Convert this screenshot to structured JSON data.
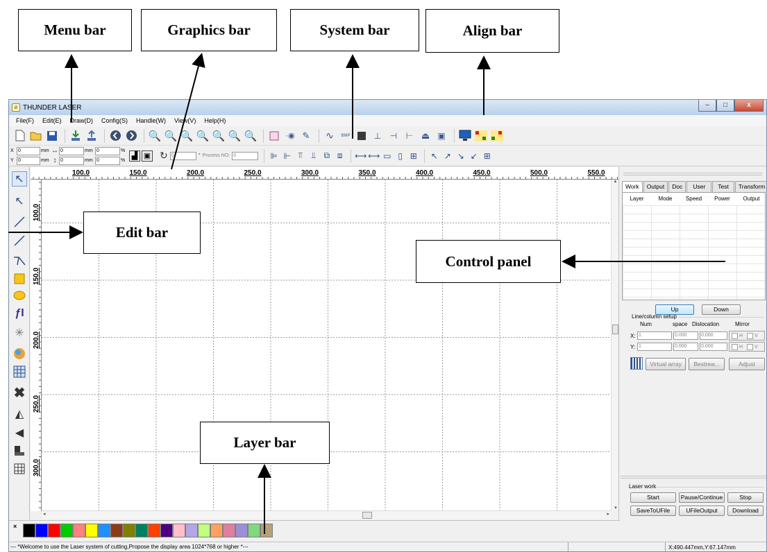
{
  "callouts": {
    "menu_bar": "Menu bar",
    "graphics_bar": "Graphics bar",
    "system_bar": "System bar",
    "align_bar": "Align bar",
    "edit_bar": "Edit bar",
    "control_panel": "Control panel",
    "layer_bar": "Layer bar"
  },
  "window": {
    "title": "THUNDER LASER",
    "controls": {
      "minimize": "–",
      "maximize": "□",
      "close": "x"
    }
  },
  "menu": [
    "File(F)",
    "Edit(E)",
    "Draw(D)",
    "Config(S)",
    "Handle(W)",
    "View(V)",
    "Help(H)"
  ],
  "toolbar1_icons": [
    "new-file-icon",
    "open-folder-icon",
    "save-icon",
    "import-icon",
    "export-icon",
    "back-icon",
    "forward-icon",
    "zoom-in-icon",
    "zoom-out-icon",
    "zoom-window-icon",
    "zoom-fit-icon",
    "zoom-page-icon",
    "zoom-data-icon",
    "zoom-icon",
    "frame-icon",
    "node-icon",
    "curve-edit-icon",
    "smooth-icon",
    "bitmap-icon",
    "stop-square-icon",
    "network-icon",
    "hmirror-icon",
    "vmirror-icon",
    "machine-icon",
    "output-icon",
    "monitor-icon",
    "align-grid-icon",
    "align-grid2-icon"
  ],
  "position_bar": {
    "x_label": "X",
    "y_label": "Y",
    "x_value": "0",
    "y_value": "0",
    "w_value": "0",
    "h_value": "0",
    "x_scale": "0",
    "y_scale": "0",
    "unit": "mm",
    "percent": "%",
    "angle_value": "0",
    "degree": "°",
    "process_label": "Process NO:",
    "process_value": "0"
  },
  "toolbar2_icons": [
    "align-left-icon",
    "align-right-icon",
    "align-top-icon",
    "align-bottom-icon",
    "align-hcenter-icon",
    "align-vcenter-icon",
    "same-width-icon",
    "same-height-icon",
    "same-size-icon",
    "space-h-icon",
    "space-v-icon",
    "arrow-nw-icon",
    "arrow-ne-icon",
    "arrow-se-icon",
    "arrow-sw-icon",
    "center-icon"
  ],
  "edit_bar_icons": [
    "select-arrow-icon",
    "node-edit-icon",
    "line-icon",
    "polyline-icon",
    "curve-icon",
    "rectangle-icon",
    "ellipse-icon",
    "text-icon",
    "point-icon",
    "bitmap-import-icon",
    "array-icon",
    "delete-icon",
    "hmirror-tool-icon",
    "vmirror-tool-icon",
    "align-tool-icon",
    "grid-tool-icon"
  ],
  "ruler": {
    "top": [
      "100.0",
      "150.0",
      "200.0",
      "250.0",
      "300.0",
      "350.0",
      "400.0",
      "450.0",
      "500.0",
      "550.0"
    ],
    "left": [
      "100.0",
      "150.0",
      "200.0",
      "250.0",
      "300.0"
    ]
  },
  "panel": {
    "tabs": [
      "Work",
      "Output",
      "Doc",
      "User",
      "Test",
      "Transform"
    ],
    "active_tab": "Work",
    "layer_columns": [
      "Layer",
      "Mode",
      "Speed",
      "Power",
      "Output"
    ],
    "up": "Up",
    "down": "Down",
    "line_column_setup": "Line/column setup",
    "lc_headers": [
      "Num",
      "space",
      "Dislocation",
      "Mirror"
    ],
    "x_label": "X:",
    "y_label": "Y:",
    "x_num": "1",
    "y_num": "1",
    "x_space": "0.000",
    "y_space": "0.000",
    "x_disloc": "0.000",
    "y_disloc": "0.000",
    "mirror_h": "H",
    "mirror_v": "V",
    "virtual_array": "Virtual array",
    "bestrew": "Bestrew...",
    "adjust": "Adjust",
    "laser_work": "Laser work",
    "start": "Start",
    "pause": "Pause/Continue",
    "stop": "Stop",
    "save_u": "SaveToUFile",
    "u_output": "UFileOutput",
    "download": "Download"
  },
  "layer_colors": [
    "#000000",
    "#0000ff",
    "#ff0000",
    "#00cc00",
    "#ff8080",
    "#ffff00",
    "#1e90ff",
    "#8b3a1a",
    "#808000",
    "#008060",
    "#ff4000",
    "#4b0082",
    "#ffc0cb",
    "#b3a6e6",
    "#c0ff80",
    "#ffa060",
    "#e080a0",
    "#9d8fd6",
    "#80d880",
    "#b8a078"
  ],
  "status": {
    "message": "--- *Welcome to use the Laser system of cutting,Propose the display area 1024*768 or higher *---",
    "coords": "X:490.447mm,Y:67.147mm"
  }
}
